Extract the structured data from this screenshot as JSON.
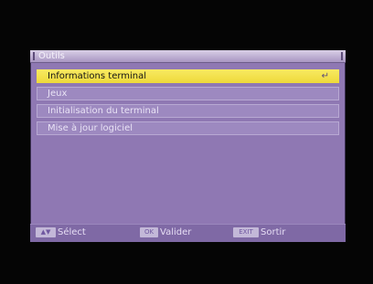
{
  "window": {
    "title": "Outils"
  },
  "menu": {
    "items": [
      {
        "label": "Informations terminal",
        "selected": true
      },
      {
        "label": "Jeux",
        "selected": false
      },
      {
        "label": "Initialisation du terminal",
        "selected": false
      },
      {
        "label": "Mise à jour logiciel",
        "selected": false
      }
    ],
    "enter_icon": "enter-icon",
    "enter_glyph": "↵"
  },
  "footer": {
    "select": {
      "key": "▲▼",
      "label": "Sélect"
    },
    "ok": {
      "key": "OK",
      "label": "Valider"
    },
    "exit": {
      "key": "EXIT",
      "label": "Sortir"
    }
  },
  "colors": {
    "window_bg": "#8f78b3",
    "selected_bg": "#f3e24a",
    "item_bg": "#9d89c0",
    "screen_bg": "#050505"
  }
}
